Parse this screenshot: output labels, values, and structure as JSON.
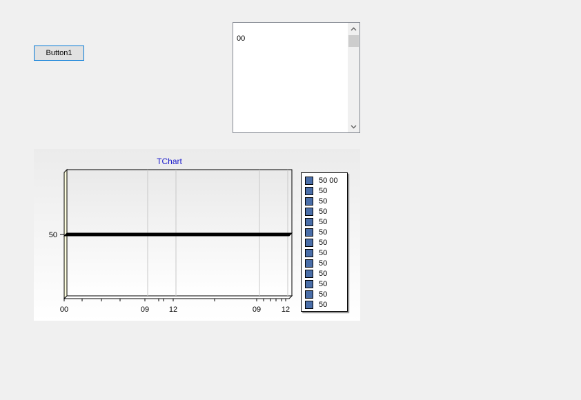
{
  "button1": {
    "label": "Button1"
  },
  "memo": {
    "text": "00"
  },
  "chart": {
    "title": "TChart",
    "legend_items": [
      "50 00",
      "50",
      "50",
      "50",
      "50",
      "50",
      "50",
      "50",
      "50",
      "50",
      "50",
      "50",
      "50"
    ],
    "colors": {
      "series": "#4a6ea8",
      "title": "#1d1dcc",
      "line": "#000000"
    }
  },
  "chart_data": {
    "type": "line",
    "title": "TChart",
    "xlabel": "",
    "ylabel": "",
    "x_tick_labels": [
      "00",
      "09",
      "12",
      "09",
      "12"
    ],
    "y_tick_labels": [
      "50"
    ],
    "series": [
      {
        "x": [
          "00",
          "09",
          "12",
          "09",
          "12"
        ],
        "values": [
          50,
          50,
          50,
          50,
          50
        ]
      }
    ],
    "grid": true,
    "legend_placement": "right"
  }
}
